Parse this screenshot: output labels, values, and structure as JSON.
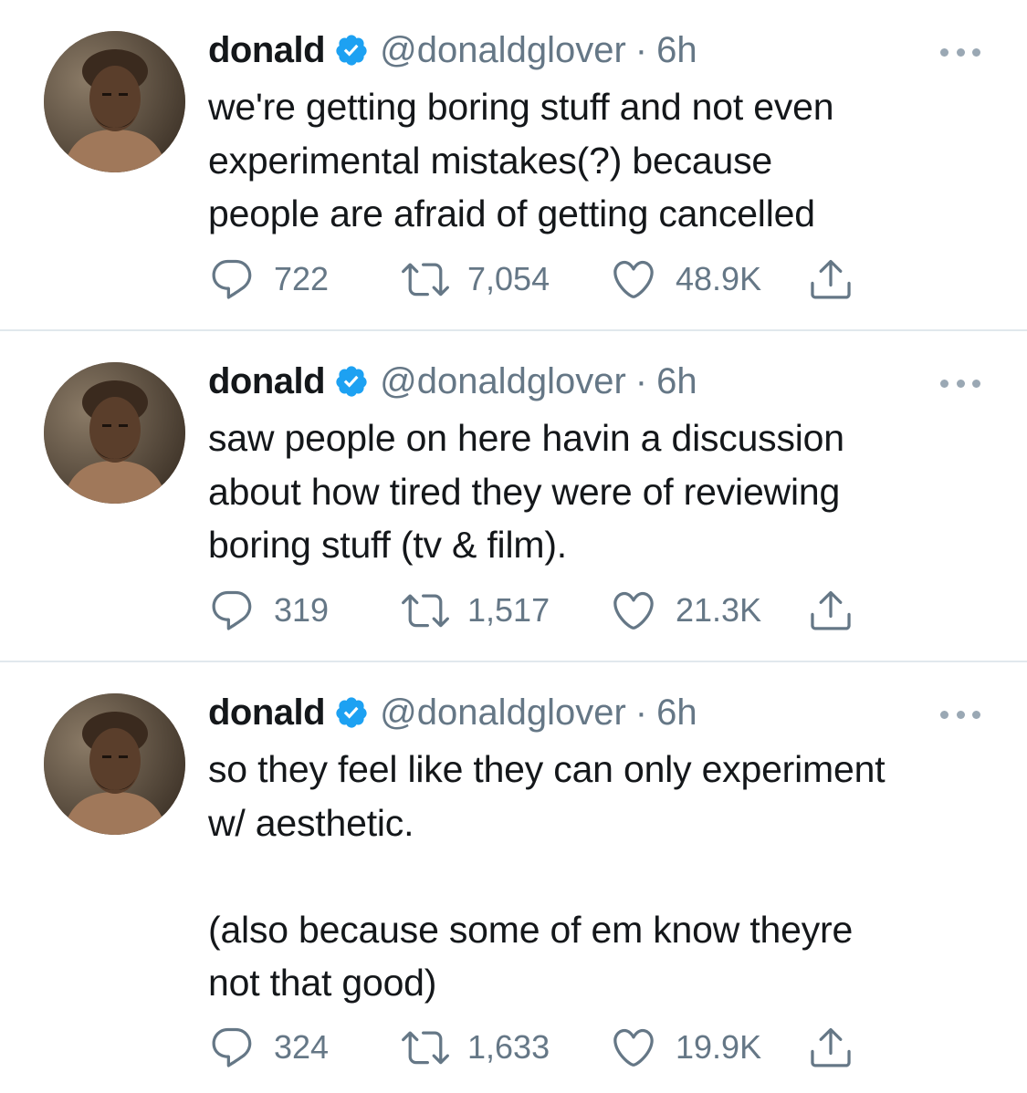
{
  "tweets": [
    {
      "author": {
        "name": "donald",
        "handle": "@donaldglover"
      },
      "separator": "·",
      "time": "6h",
      "text": "we're getting boring stuff and not even\nexperimental mistakes(?) because\npeople are afraid of getting cancelled",
      "stats": {
        "replies": "722",
        "retweets": "7,054",
        "likes": "48.9K"
      }
    },
    {
      "author": {
        "name": "donald",
        "handle": "@donaldglover"
      },
      "separator": "·",
      "time": "6h",
      "text": "saw people on here havin a discussion\nabout how tired they were of reviewing\nboring stuff (tv & film).",
      "stats": {
        "replies": "319",
        "retweets": "1,517",
        "likes": "21.3K"
      }
    },
    {
      "author": {
        "name": "donald",
        "handle": "@donaldglover"
      },
      "separator": "·",
      "time": "6h",
      "text": "so they feel like they can only experiment\nw/ aesthetic.\n\n(also because some of em know theyre\nnot that good)",
      "stats": {
        "replies": "324",
        "retweets": "1,633",
        "likes": "19.9K"
      }
    }
  ],
  "icons": {
    "verified": "verified-badge-icon",
    "more": "more-options-icon",
    "reply": "reply-icon",
    "retweet": "retweet-icon",
    "like": "heart-icon",
    "share": "share-icon"
  },
  "colors": {
    "verified": "#1da1f2",
    "secondary_text": "#657786",
    "primary_text": "#14171a",
    "divider": "#e1e8ed"
  }
}
